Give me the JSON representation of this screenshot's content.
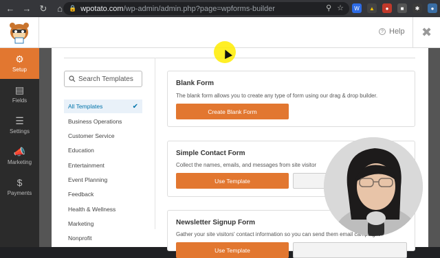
{
  "browser": {
    "url_host": "wpotato.com",
    "url_path": "/wp-admin/admin.php?page=wpforms-builder"
  },
  "header": {
    "help_label": "Help"
  },
  "sidebar": {
    "items": [
      {
        "label": "Setup",
        "icon": "gear-icon"
      },
      {
        "label": "Fields",
        "icon": "fields-icon"
      },
      {
        "label": "Settings",
        "icon": "sliders-icon"
      },
      {
        "label": "Marketing",
        "icon": "megaphone-icon"
      },
      {
        "label": "Payments",
        "icon": "dollar-icon"
      }
    ]
  },
  "templates": {
    "search_placeholder": "Search Templates",
    "categories": [
      "All Templates",
      "Business Operations",
      "Customer Service",
      "Education",
      "Entertainment",
      "Event Planning",
      "Feedback",
      "Health & Wellness",
      "Marketing",
      "Nonprofit"
    ],
    "cards": [
      {
        "title": "Blank Form",
        "description": "The blank form allows you to create any type of form using our drag & drop builder.",
        "primary_label": "Create Blank Form"
      },
      {
        "title": "Simple Contact Form",
        "description": "Collect the names, emails, and messages from site visitor",
        "primary_label": "Use Template"
      },
      {
        "title": "Newsletter Signup Form",
        "description": "Gather your site visitors' contact information so you can send them email campaigns.",
        "primary_label": "Use Template"
      }
    ]
  },
  "colors": {
    "accent": "#e27730",
    "sidebar_bg": "#2b2b2b",
    "link_blue": "#0073aa"
  }
}
